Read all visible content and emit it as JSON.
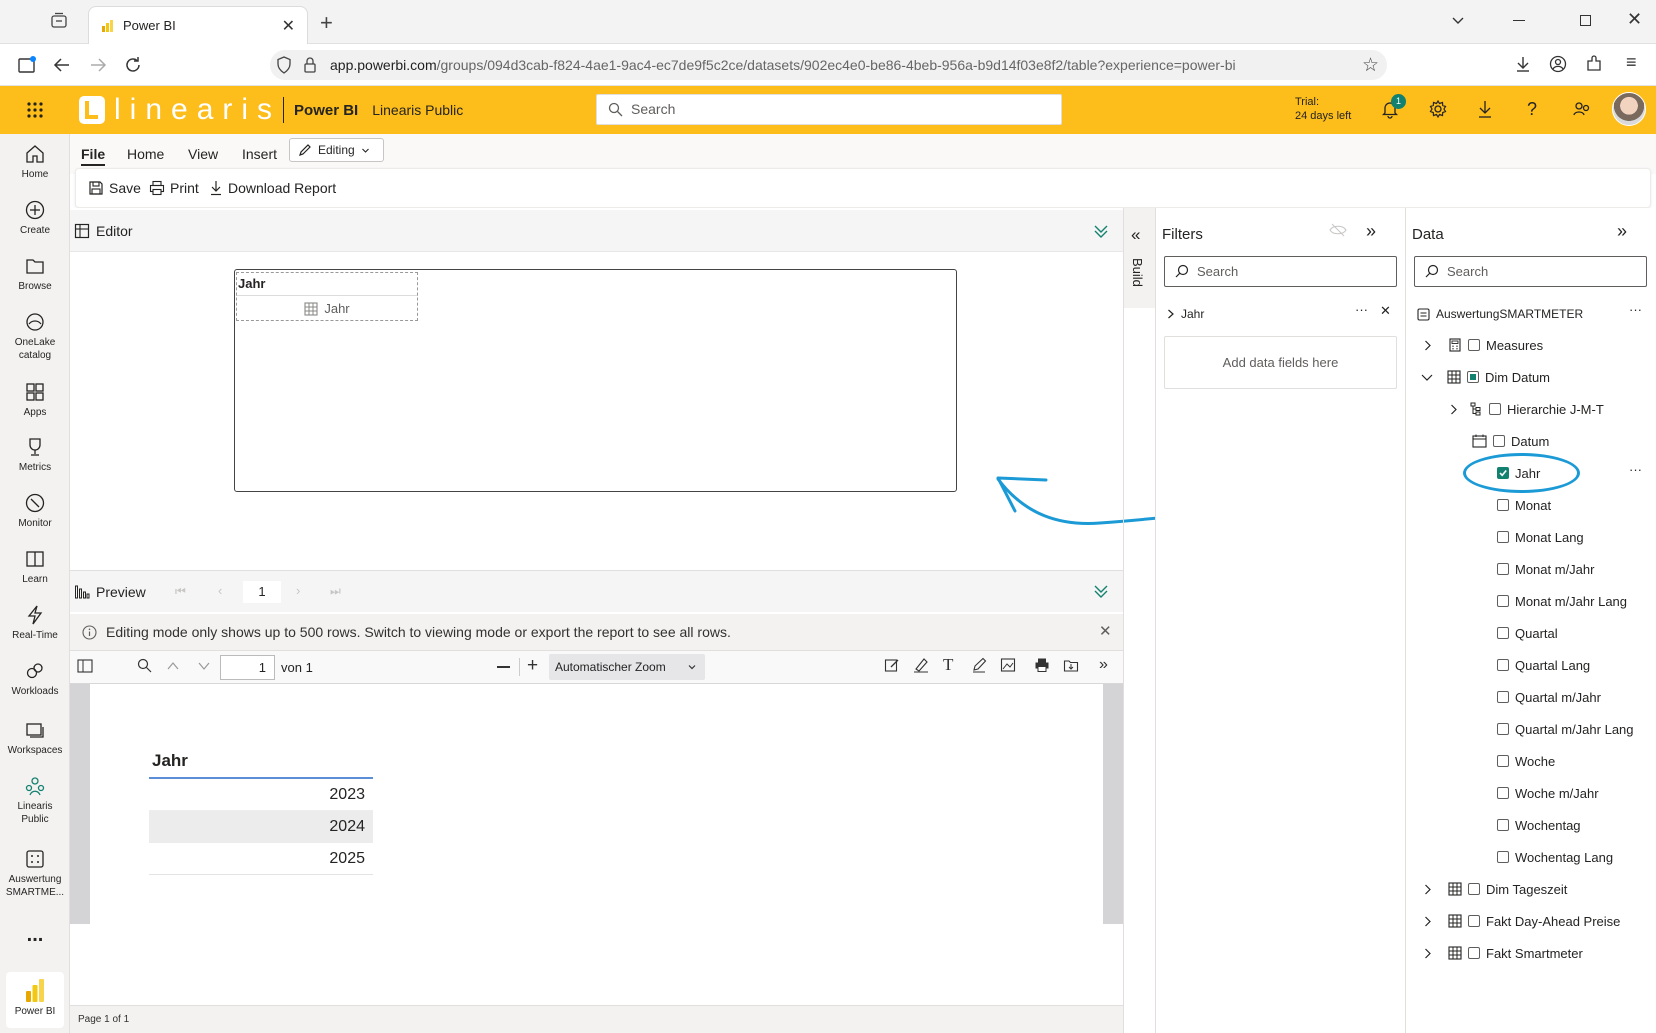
{
  "browser": {
    "tab_title": "Power BI",
    "url_host": "app.powerbi.com",
    "url_path": "/groups/094d3cab-f824-4ae1-9ac4-ec7de9f5c2ce/datasets/902ec4e0-be86-4beb-956a-b9d14f03e8f2/table?experience=power-bi"
  },
  "header": {
    "logo_text": "linearis",
    "app_name": "Power BI",
    "workspace": "Linearis Public",
    "search_placeholder": "Search",
    "trial_line1": "Trial:",
    "trial_line2": "24 days left",
    "notification_count": "1"
  },
  "leftnav": {
    "items": [
      {
        "label": "Home"
      },
      {
        "label": "Create"
      },
      {
        "label": "Browse"
      },
      {
        "label": "OneLake catalog"
      },
      {
        "label": "Apps"
      },
      {
        "label": "Metrics"
      },
      {
        "label": "Monitor"
      },
      {
        "label": "Learn"
      },
      {
        "label": "Real-Time"
      },
      {
        "label": "Workloads"
      },
      {
        "label": "Workspaces"
      },
      {
        "label": "Linearis Public"
      },
      {
        "label": "Auswertung SMARTME..."
      }
    ],
    "more": "...",
    "bottom_label": "Power BI"
  },
  "ribbon": {
    "tabs": [
      "File",
      "Home",
      "View",
      "Insert"
    ],
    "active_tab": "File",
    "mode": "Editing",
    "save": "Save",
    "print": "Print",
    "download": "Download Report"
  },
  "editor": {
    "title": "Editor",
    "table_header": "Jahr",
    "drop_field": "Jahr"
  },
  "preview": {
    "title": "Preview",
    "page_number": "1",
    "notice": "Editing mode only shows up to 500 rows. Switch to viewing mode or export the report to see all rows.",
    "pdf_page": "1",
    "pdf_of": "von 1",
    "zoom": "Automatischer Zoom",
    "table_header": "Jahr",
    "rows": [
      "2023",
      "2024",
      "2025"
    ],
    "status": "Page 1 of 1"
  },
  "build_label": "Build",
  "filters": {
    "title": "Filters",
    "search_placeholder": "Search",
    "filter_field": "Jahr",
    "add_fields": "Add data fields here"
  },
  "data": {
    "title": "Data",
    "search_placeholder": "Search",
    "model": "AuswertungSMARTMETER",
    "tables": [
      {
        "name": "Measures"
      },
      {
        "name": "Dim Datum"
      },
      {
        "name": "Dim Tageszeit"
      },
      {
        "name": "Fakt Day-Ahead Preise"
      },
      {
        "name": "Fakt Smartmeter"
      }
    ],
    "dim_datum_fields": [
      "Hierarchie J-M-T",
      "Datum",
      "Jahr",
      "Monat",
      "Monat Lang",
      "Monat m/Jahr",
      "Monat m/Jahr Lang",
      "Quartal",
      "Quartal Lang",
      "Quartal m/Jahr",
      "Quartal m/Jahr Lang",
      "Woche",
      "Woche m/Jahr",
      "Wochentag",
      "Wochentag Lang"
    ],
    "checked_field": "Jahr"
  },
  "colors": {
    "pbi_yellow": "#fdbd1a",
    "annotation_blue": "#1b9ad6",
    "check_green": "#13816f"
  }
}
